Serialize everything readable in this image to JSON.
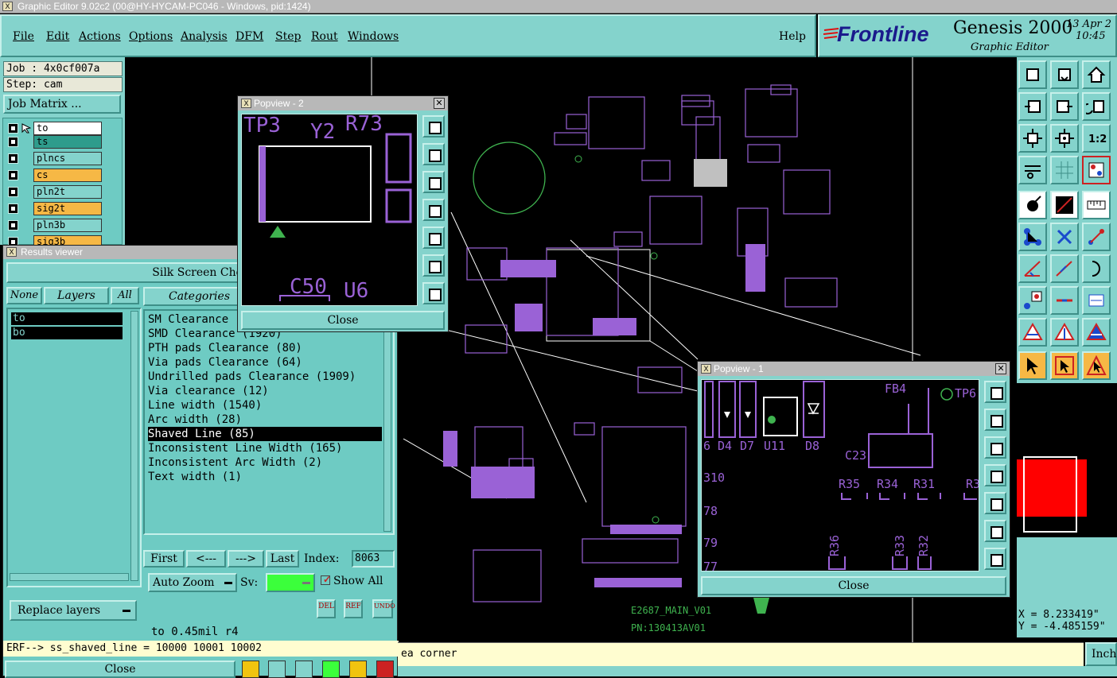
{
  "window_title": "Graphic Editor 9.02c2 (00@HY-HYCAM-PC046 - Windows, pid:1424)",
  "menu": [
    "File",
    "Edit",
    "Actions",
    "Options",
    "Analysis",
    "DFM",
    "Step",
    "Rout",
    "Windows"
  ],
  "help": "Help",
  "brand": {
    "logo": "Frontline",
    "product": "Genesis 2000",
    "subtitle": "Graphic Editor",
    "date": "13 Apr 2",
    "time": "10:45"
  },
  "job": "Job : 4x0cf007a",
  "step": "Step: cam",
  "job_matrix": "Job Matrix ...",
  "layers": [
    {
      "name": "to",
      "color": "#ffffff"
    },
    {
      "name": "ts",
      "color": "#2e9c8c"
    },
    {
      "name": "plncs",
      "color": "#84d3cc"
    },
    {
      "name": "cs",
      "color": "#f6b845"
    },
    {
      "name": "pln2t",
      "color": "#84d3cc"
    },
    {
      "name": "sig2t",
      "color": "#f6b845"
    },
    {
      "name": "pln3b",
      "color": "#84d3cc"
    },
    {
      "name": "sig3b",
      "color": "#f6b845"
    }
  ],
  "results": {
    "title": "Results viewer",
    "header": "Silk Screen Chec",
    "none": "None",
    "layers_tab": "Layers",
    "all": "All",
    "categories_label": "Categories",
    "layer_list": [
      "to",
      "bo"
    ],
    "categories": [
      "SM Clearance",
      "SMD Clearance (1920)",
      "PTH pads Clearance (80)",
      "Via pads Clearance (64)",
      "Undrilled pads Clearance (1909)",
      "Via clearance (12)",
      "Line width (1540)",
      "Arc width (28)",
      "Shaved Line (85)",
      "Inconsistent Line Width (165)",
      "Inconsistent Arc Width (2)",
      "Text width (1)"
    ],
    "first": "First",
    "prev": "<---",
    "next": "--->",
    "last": "Last",
    "index_label": "Index:",
    "index_value": "8063",
    "auto_zoom": "Auto Zoom",
    "sv": "Sv:",
    "show_all": "Show All",
    "replace_layers": "Replace layers",
    "del": "DEL",
    "ref": "REF",
    "undo": "UNDO",
    "detail": "to 0.45mil  r4",
    "erf": "ERF--> ss_shaved_line = 10000 10001 10002",
    "close": "Close"
  },
  "popview2": {
    "title": "Popview - 2",
    "close": "Close",
    "labels": [
      "TP3",
      "Y2",
      "R73",
      "C50",
      "U6"
    ]
  },
  "popview1": {
    "title": "Popview - 1",
    "close": "Close",
    "labels": [
      "FB4",
      "TP6",
      "6",
      "D4",
      "D7",
      "U11",
      "D8",
      "C23",
      "R35",
      "R34",
      "R31",
      "R3",
      "310",
      "78",
      "79",
      "77",
      "R36",
      "R33",
      "R32"
    ]
  },
  "board_text": [
    "E2687_MAIN_V01",
    "PN:130413AV01"
  ],
  "status_text": "ea corner",
  "coords": {
    "x": "X =  8.233419\"",
    "y": "Y = -4.485159\""
  },
  "units_button": "Inch"
}
